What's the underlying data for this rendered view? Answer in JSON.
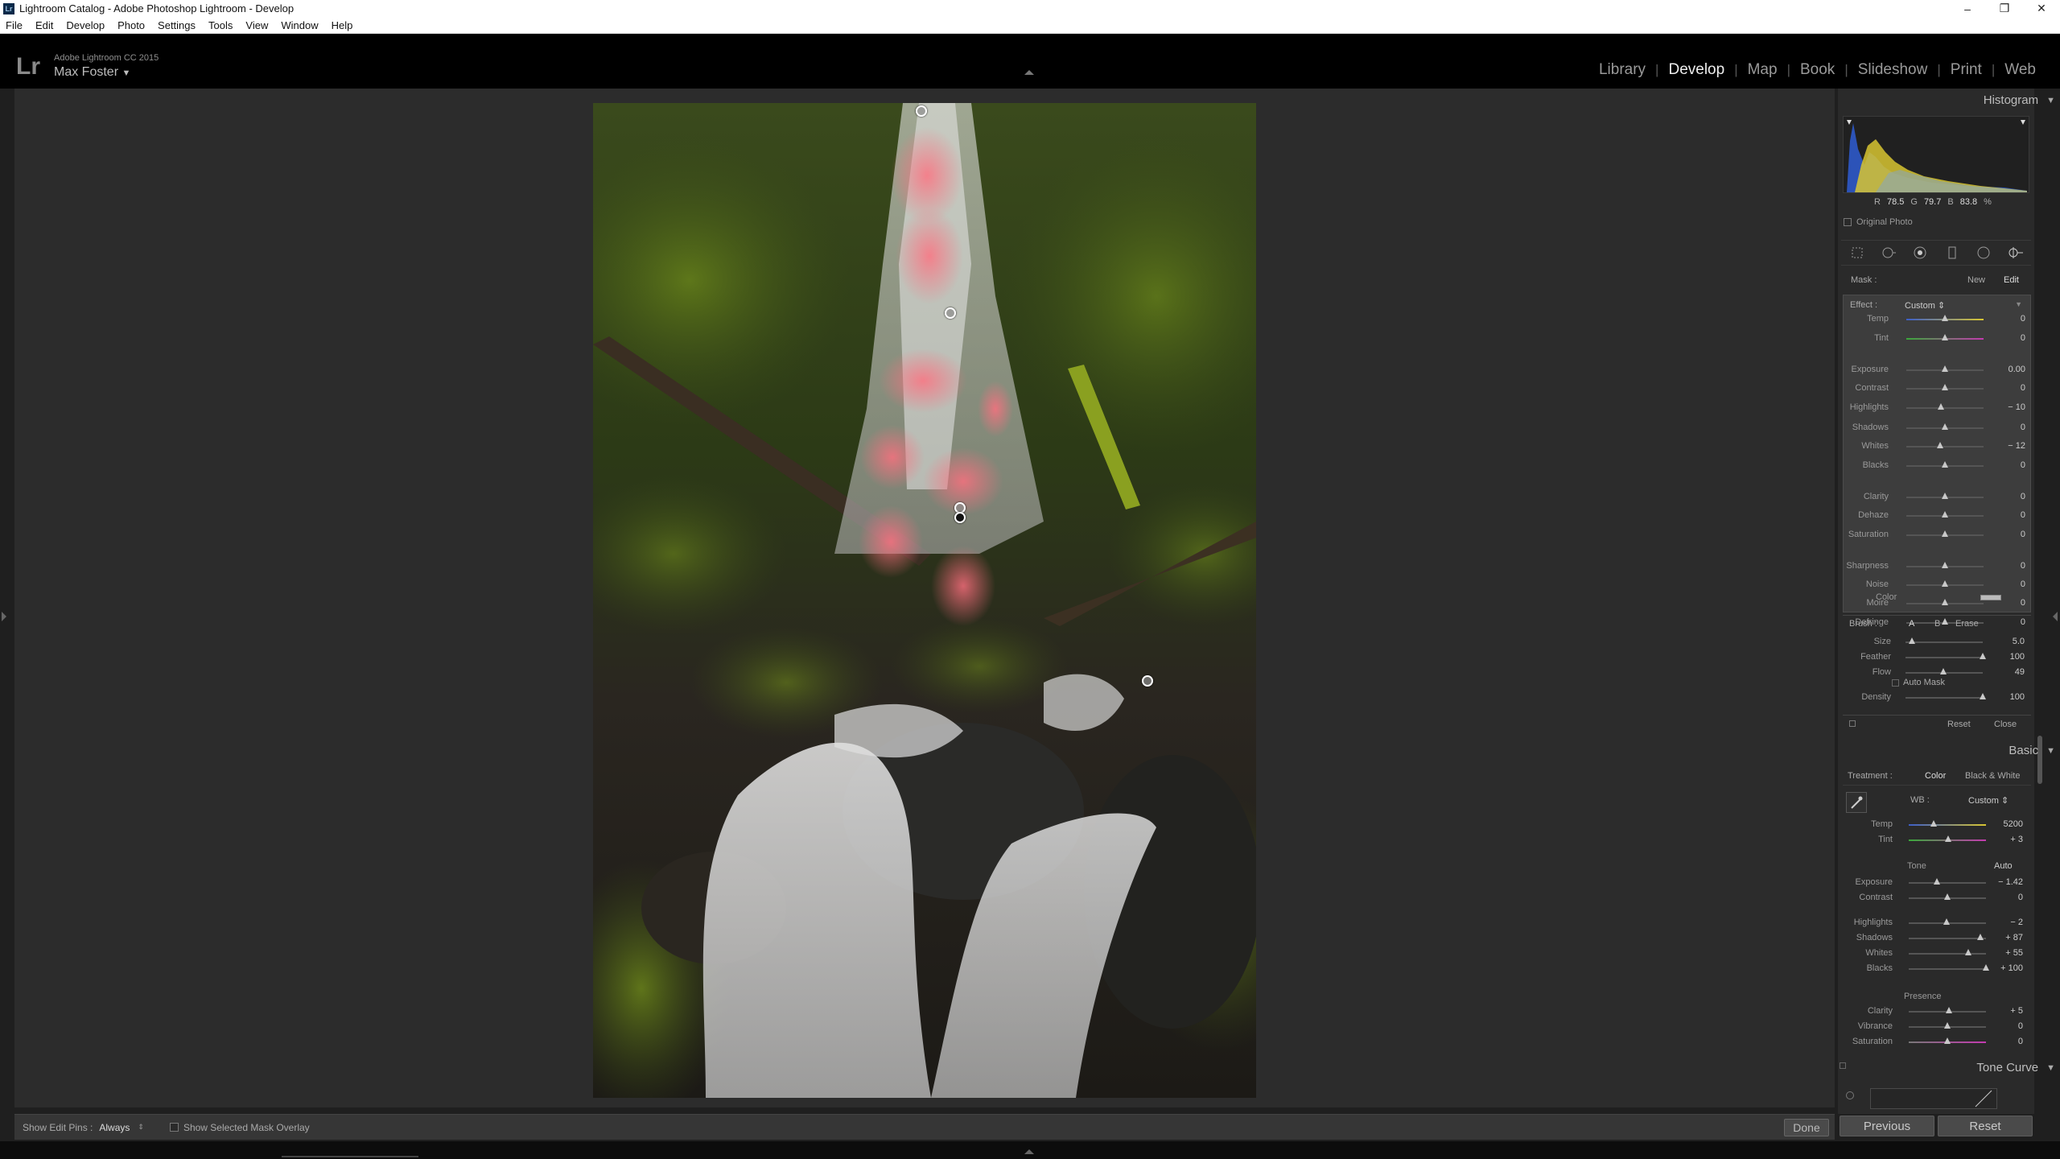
{
  "window": {
    "title": "Lightroom Catalog - Adobe Photoshop Lightroom - Develop",
    "app_icon": "Lr"
  },
  "menu": [
    "File",
    "Edit",
    "Develop",
    "Photo",
    "Settings",
    "Tools",
    "View",
    "Window",
    "Help"
  ],
  "identity": {
    "logo": "Lr",
    "product": "Adobe Lightroom CC 2015",
    "user": "Max Foster",
    "user_arrow": "▼"
  },
  "modules": [
    "Library",
    "Develop",
    "Map",
    "Book",
    "Slideshow",
    "Print",
    "Web"
  ],
  "active_module": "Develop",
  "histogram": {
    "title": "Histogram",
    "r_label": "R",
    "r": "78.5",
    "g_label": "G",
    "g": "79.7",
    "b_label": "B",
    "b": "83.8",
    "unit": "%",
    "original_photo": "Original Photo"
  },
  "mask": {
    "label": "Mask :",
    "new": "New",
    "edit": "Edit"
  },
  "effect": {
    "label": "Effect :",
    "value": "Custom",
    "sliders": [
      {
        "label": "Temp",
        "value": "0",
        "pos": 0.5
      },
      {
        "label": "Tint",
        "value": "0",
        "pos": 0.5
      },
      {
        "label": "Exposure",
        "value": "0.00",
        "pos": 0.5
      },
      {
        "label": "Contrast",
        "value": "0",
        "pos": 0.5
      },
      {
        "label": "Highlights",
        "value": "− 10",
        "pos": 0.45
      },
      {
        "label": "Shadows",
        "value": "0",
        "pos": 0.5
      },
      {
        "label": "Whites",
        "value": "− 12",
        "pos": 0.44
      },
      {
        "label": "Blacks",
        "value": "0",
        "pos": 0.5
      },
      {
        "label": "Clarity",
        "value": "0",
        "pos": 0.5
      },
      {
        "label": "Dehaze",
        "value": "0",
        "pos": 0.5
      },
      {
        "label": "Saturation",
        "value": "0",
        "pos": 0.5
      },
      {
        "label": "Sharpness",
        "value": "0",
        "pos": 0.5
      },
      {
        "label": "Noise",
        "value": "0",
        "pos": 0.5
      },
      {
        "label": "Moire",
        "value": "0",
        "pos": 0.5
      },
      {
        "label": "Defringe",
        "value": "0",
        "pos": 0.5
      }
    ],
    "color_label": "Color"
  },
  "brush": {
    "label": "Brush :",
    "a": "A",
    "b": "B",
    "erase": "Erase",
    "sliders": [
      {
        "label": "Size",
        "value": "5.0",
        "pos": 0.08
      },
      {
        "label": "Feather",
        "value": "100",
        "pos": 1.0
      },
      {
        "label": "Flow",
        "value": "49",
        "pos": 0.49
      }
    ],
    "auto_mask": "Auto Mask",
    "density": {
      "label": "Density",
      "value": "100",
      "pos": 1.0
    },
    "reset": "Reset",
    "close": "Close"
  },
  "basic": {
    "title": "Basic",
    "treatment_label": "Treatment :",
    "color": "Color",
    "bw": "Black & White",
    "wb_label": "WB :",
    "wb_value": "Custom",
    "wb_sliders": [
      {
        "label": "Temp",
        "value": "5200",
        "pos": 0.32
      },
      {
        "label": "Tint",
        "value": "+ 3",
        "pos": 0.51
      }
    ],
    "tone_label": "Tone",
    "auto": "Auto",
    "tone_sliders": [
      {
        "label": "Exposure",
        "value": "− 1.42",
        "pos": 0.36
      },
      {
        "label": "Contrast",
        "value": "0",
        "pos": 0.5
      }
    ],
    "tone_sliders2": [
      {
        "label": "Highlights",
        "value": "− 2",
        "pos": 0.49
      },
      {
        "label": "Shadows",
        "value": "+ 87",
        "pos": 0.93
      },
      {
        "label": "Whites",
        "value": "+ 55",
        "pos": 0.77
      },
      {
        "label": "Blacks",
        "value": "+ 100",
        "pos": 1.0
      }
    ],
    "presence_label": "Presence",
    "presence_sliders": [
      {
        "label": "Clarity",
        "value": "+ 5",
        "pos": 0.52
      },
      {
        "label": "Vibrance",
        "value": "0",
        "pos": 0.5
      },
      {
        "label": "Saturation",
        "value": "0",
        "pos": 0.5
      }
    ]
  },
  "tone_curve": {
    "title": "Tone Curve"
  },
  "toolbar": {
    "show_pins_label": "Show Edit Pins :",
    "show_pins_value": "Always",
    "overlay_label": "Show Selected Mask Overlay",
    "done": "Done"
  },
  "bottom": {
    "previous": "Previous",
    "reset": "Reset"
  },
  "colors": {
    "accent_mask": "#e05a6a",
    "panel": "#2a2a2a",
    "active_text": "#eeeeee"
  }
}
